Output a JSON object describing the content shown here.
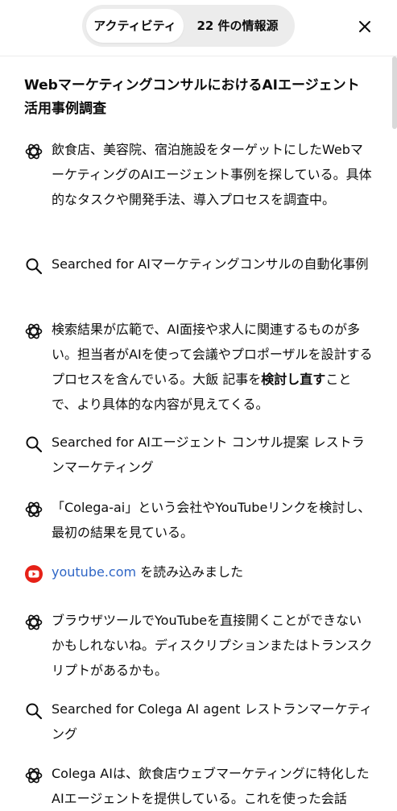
{
  "header": {
    "tab_activity": "アクティビティ",
    "tab_sources": "22 件の情報源"
  },
  "title": "WebマーケティングコンサルにおけるAIエージェント活用事例調査",
  "items": {
    "i1": "飲食店、美容院、宿泊施設をターゲットにしたWebマーケティングのAIエージェント事例を探している。具体的なタスクや開発手法、導入プロセスを調査中。",
    "i2": "Searched for AIマーケティングコンサルの自動化事例",
    "i3_a": "検索結果が広範で、AI面接や求人に関連するものが多い。担当者がAIを使って会議やプロポーザルを設計するプロセスを含んでいる。大飯 記事を",
    "i3_b": "検討し直す",
    "i3_c": "ことで、より具体的な内容が見えてくる。",
    "i4": "Searched for AIエージェント コンサル提案 レストランマーケティング",
    "i5": "「Colega-ai」という会社やYouTubeリンクを検討し、最初の結果を見ている。",
    "i6_link": "youtube.com",
    "i6_rest": " を読み込みました",
    "i7": "ブラウザツールでYouTubeを直接開くことができないかもしれないね。ディスクリプションまたはトランスクリプトがあるかも。",
    "i8": "Searched for Colega AI agent レストランマーケティング",
    "i9": "Colega AIは、飲食店ウェブマーケティングに特化したAIエージェントを提供している。これを使った会話"
  },
  "colors": {
    "link": "#2f66c6",
    "youtube": "#e62117"
  }
}
